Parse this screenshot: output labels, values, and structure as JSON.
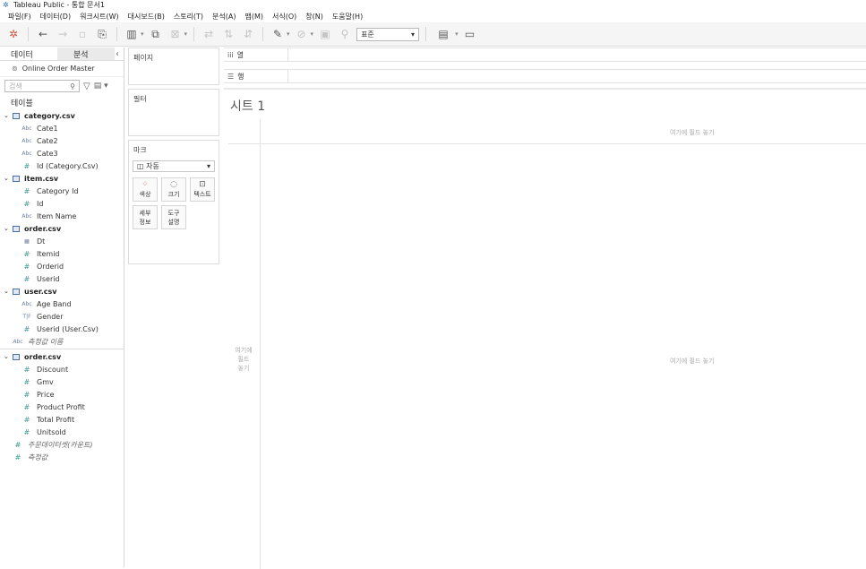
{
  "window": {
    "title": "Tableau Public - 통합 문서1"
  },
  "menu": [
    "파일(F)",
    "데이터(D)",
    "워크시트(W)",
    "대시보드(B)",
    "스토리(T)",
    "분석(A)",
    "맵(M)",
    "서식(O)",
    "창(N)",
    "도움말(H)"
  ],
  "toolbar": {
    "fit_value": "표준"
  },
  "datapane": {
    "tabs": [
      "데이터",
      "분석"
    ],
    "datasource": "Online Order Master",
    "search_placeholder": "검색",
    "tables_label": "테이블",
    "tables": [
      {
        "name": "category.csv",
        "fields": [
          {
            "type": "Abc",
            "name": "Cate1"
          },
          {
            "type": "Abc",
            "name": "Cate2"
          },
          {
            "type": "Abc",
            "name": "Cate3"
          },
          {
            "type": "#",
            "name": "Id (Category.Csv)"
          }
        ]
      },
      {
        "name": "item.csv",
        "fields": [
          {
            "type": "#",
            "name": "Category Id"
          },
          {
            "type": "#",
            "name": "Id"
          },
          {
            "type": "Abc",
            "name": "Item Name"
          }
        ]
      },
      {
        "name": "order.csv",
        "fields": [
          {
            "type": "date",
            "name": "Dt"
          },
          {
            "type": "#",
            "name": "Itemid"
          },
          {
            "type": "#",
            "name": "Orderid"
          },
          {
            "type": "#",
            "name": "Userid"
          }
        ]
      },
      {
        "name": "user.csv",
        "fields": [
          {
            "type": "Abc",
            "name": "Age Band"
          },
          {
            "type": "T|F",
            "name": "Gender"
          },
          {
            "type": "#",
            "name": "Userid (User.Csv)"
          }
        ]
      }
    ],
    "measure_names": "측정값 이름",
    "measures_table": {
      "name": "order.csv",
      "fields": [
        "Discount",
        "Gmv",
        "Price",
        "Product Profit",
        "Total Profit",
        "Unitsold"
      ]
    },
    "count_field": "주문데이터셋(카운트)",
    "measure_values": "측정값"
  },
  "cards": {
    "pages": "페이지",
    "filters": "필터",
    "marks": "마크",
    "marks_type": "자동",
    "mark_buttons": [
      {
        "icon": "color-icon",
        "label": "색상"
      },
      {
        "icon": "size-icon",
        "label": "크기"
      },
      {
        "icon": "text-icon",
        "label": "텍스트"
      },
      {
        "icon": "detail-icon",
        "label": "세부\n정보"
      },
      {
        "icon": "tooltip-icon",
        "label": "도구\n설명"
      }
    ]
  },
  "shelves": {
    "columns": "열",
    "rows": "행"
  },
  "sheet": {
    "title": "시트 1",
    "drop_top": "여기에 필드 놓기",
    "drop_left": "여기에\n필드\n놓기",
    "drop_center": "여기에 필드 놓기"
  }
}
